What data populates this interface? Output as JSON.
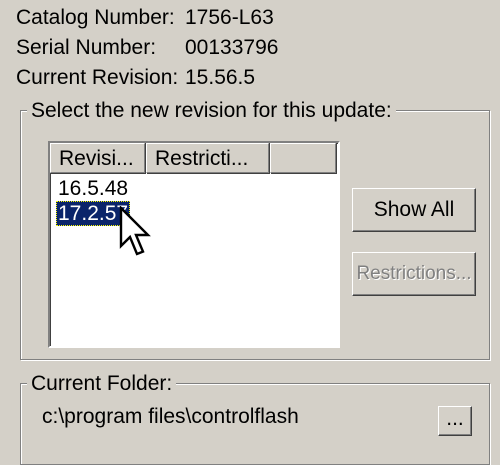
{
  "info": {
    "catalog_label": "Catalog Number:",
    "catalog_value": "1756-L63",
    "serial_label": "Serial Number:",
    "serial_value": "00133796",
    "revision_label": "Current Revision:",
    "revision_value": "15.56.5"
  },
  "revision_group": {
    "caption": "Select the new revision for this update:",
    "columns": [
      "Revisi...",
      "Restricti..."
    ],
    "items": [
      {
        "label": "16.5.48",
        "selected": false
      },
      {
        "label": "17.2.57",
        "selected": true
      }
    ],
    "show_all_label": "Show All",
    "restrictions_label": "Restrictions..."
  },
  "folder_group": {
    "caption": "Current Folder:",
    "path": "c:\\program files\\controlflash",
    "browse_label": "..."
  },
  "colors": {
    "dialog_bg": "#d4d0c8",
    "selection_bg": "#0a246a",
    "disabled_text": "#808080"
  },
  "icons": [
    "arrow-cursor-icon"
  ]
}
